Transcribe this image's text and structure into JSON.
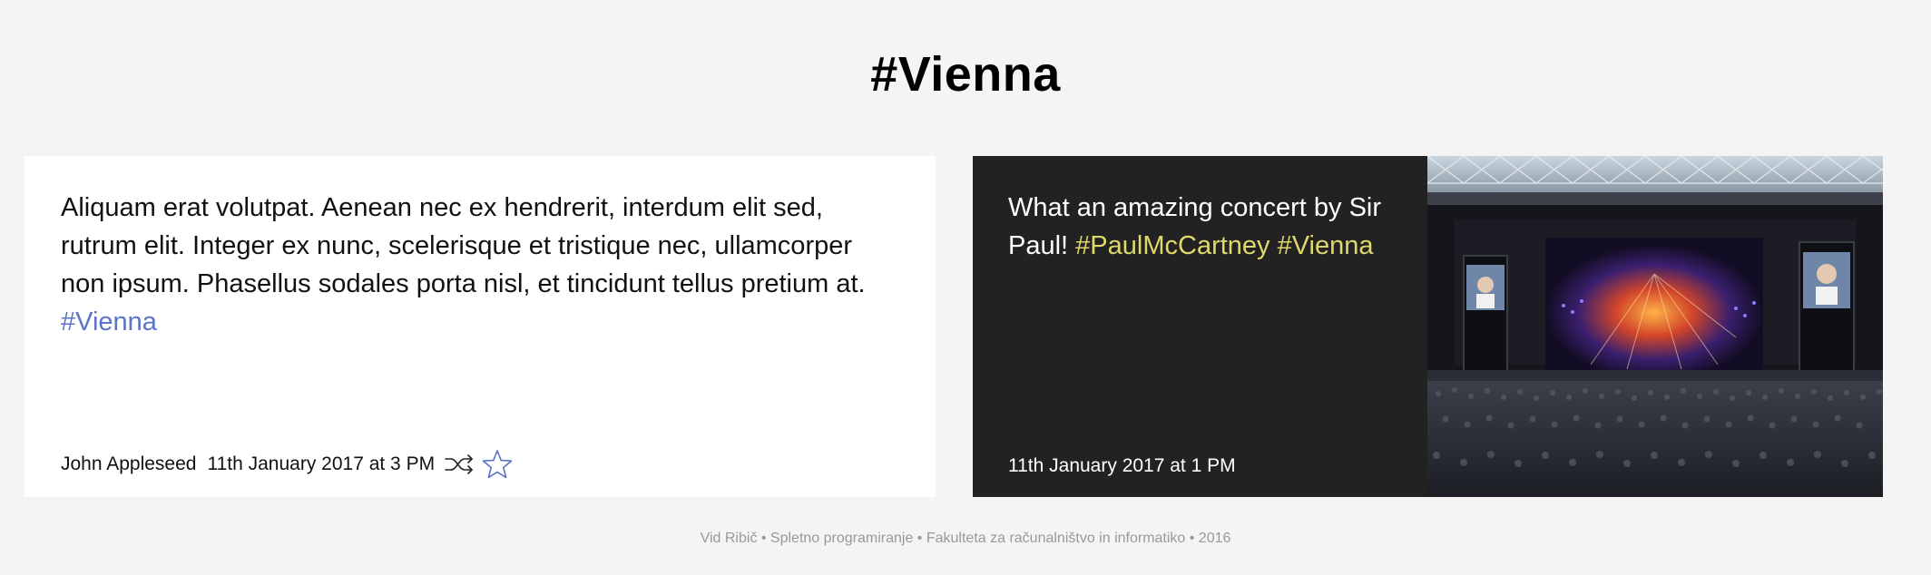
{
  "page": {
    "title": "#Vienna"
  },
  "posts": [
    {
      "text": "Aliquam erat volutpat. Aenean nec ex hendrerit, interdum elit sed, rutrum elit. Integer ex nunc, scelerisque et tristique nec, ullamcorper non ipsum. Phasellus sodales porta nisl, et tincidunt tellus pretium at.",
      "hashtags": [
        "#Vienna"
      ],
      "author": "John Appleseed",
      "time": "11th January 2017 at 3 PM",
      "actions": [
        {
          "icon": "shuffle-icon",
          "label": "retweet"
        },
        {
          "icon": "star-icon",
          "label": "favorite"
        }
      ],
      "accent_color": "#5b73c9"
    },
    {
      "text": "What an amazing concert by Sir Paul!",
      "hashtags": [
        "#PaulMcCartney",
        "#Vienna"
      ],
      "time": "11th January 2017 at 1 PM",
      "image": "concert-photo",
      "accent_color": "#dfd86a"
    }
  ],
  "footer": {
    "text": "Vid Ribič • Spletno programiranje • Fakulteta za računalništvo in informatiko • 2016"
  }
}
